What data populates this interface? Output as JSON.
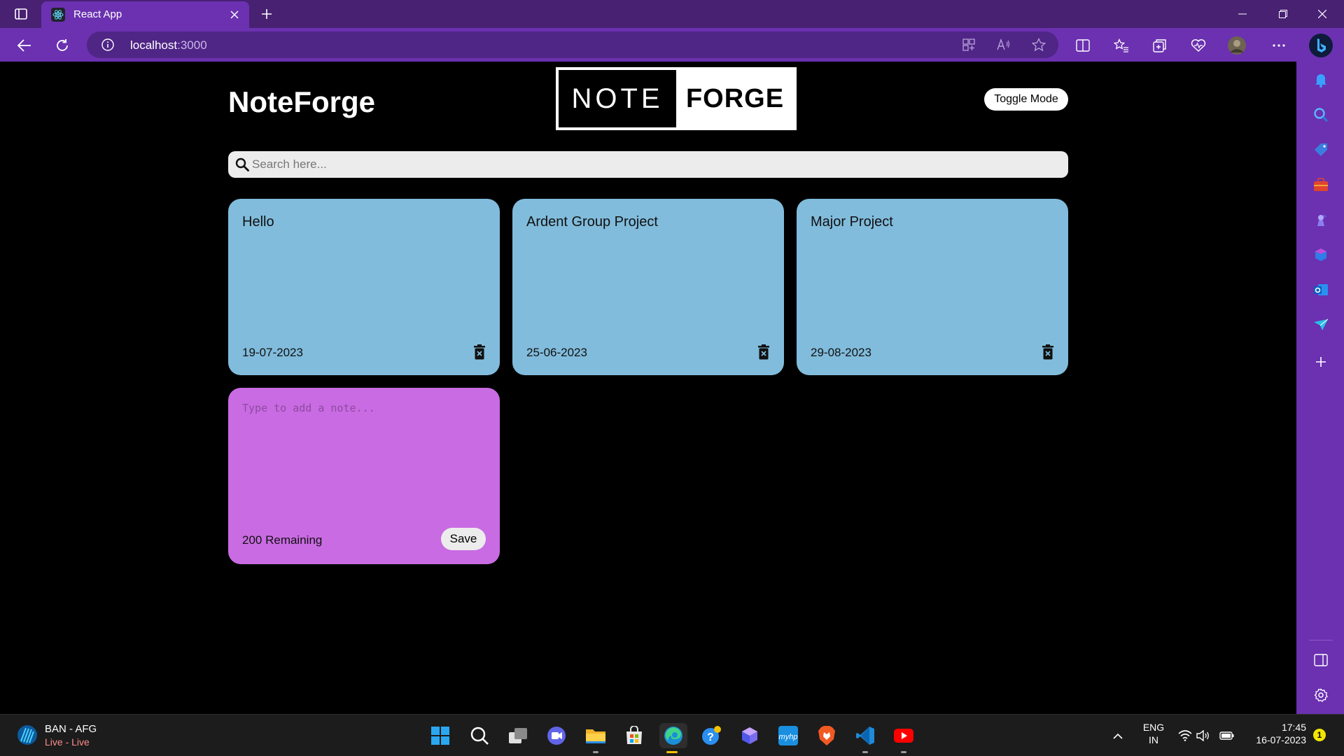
{
  "browser": {
    "tab": {
      "title": "React App",
      "favicon": "react-icon"
    },
    "url": {
      "host": "localhost",
      "port": ":3000"
    },
    "colors": {
      "frame": "#482173",
      "toolbar": "#6b31b0",
      "omnibox": "#4f2586"
    }
  },
  "app": {
    "title": "NoteForge",
    "logo": {
      "left": "NOTE",
      "right": "FORGE"
    },
    "toggle_label": "Toggle Mode",
    "search_placeholder": "Search here...",
    "notes": [
      {
        "title": "Hello",
        "date": "19-07-2023"
      },
      {
        "title": "Ardent Group Project",
        "date": "25-06-2023"
      },
      {
        "title": "Major Project",
        "date": "29-08-2023"
      }
    ],
    "new_note": {
      "placeholder": "Type to add a note...",
      "remaining": "200 Remaining",
      "save_label": "Save"
    },
    "colors": {
      "note": "#81bcdc",
      "new_note": "#c96be2",
      "background": "#000000"
    }
  },
  "taskbar": {
    "weather": {
      "title": "BAN - AFG",
      "subtitle": "Live - Live"
    },
    "language": {
      "line1": "ENG",
      "line2": "IN"
    },
    "clock": {
      "time": "17:45",
      "date": "16-07-2023"
    },
    "notification_count": "1",
    "apps": [
      "windows-start",
      "search",
      "task-view",
      "teams-meet",
      "file-explorer",
      "microsoft-store",
      "edge",
      "get-help",
      "copilot-app",
      "myhp",
      "brave",
      "vscode",
      "youtube"
    ]
  }
}
